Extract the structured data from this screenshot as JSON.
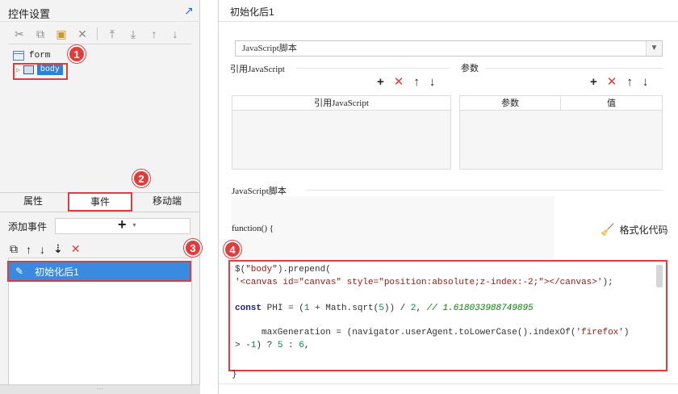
{
  "left": {
    "title": "控件设置",
    "tree": {
      "form": "form",
      "body": "body"
    },
    "tabs": [
      "属性",
      "事件",
      "移动端"
    ],
    "add_event_label": "添加事件",
    "add_event_plus": "+",
    "event_row": "初始化后1",
    "grip": "⋯"
  },
  "badges": [
    "1",
    "2",
    "3",
    "4"
  ],
  "right": {
    "title": "初始化后1",
    "select_value": "JavaScript脚本",
    "ref_section": "引用JavaScript",
    "param_section": "参数",
    "ref_col": "引用JavaScript",
    "param_cols": [
      "参数",
      "值"
    ],
    "script_section": "JavaScript脚本",
    "function_header": "function() {",
    "format_button": "格式化代码",
    "code": {
      "l1a": "$(",
      "l1b": "\"body\"",
      "l1c": ").prepend(",
      "l2": "'<canvas id=\"canvas\" style=\"position:absolute;z-index:-2;\"></canvas>'",
      "l2end": ");",
      "l4kw": "const",
      "l4a": " PHI = (",
      "l4n1": "1",
      "l4b": " + Math.sqrt(",
      "l4n2": "5",
      "l4c": ")) / ",
      "l4n3": "2",
      "l4d": ", ",
      "l4cmt": "// 1.618033988749895",
      "l6a": "     maxGeneration = (navigator.userAgent.toLowerCase().indexOf(",
      "l6s": "'firefox'",
      "l6b": ")",
      "l7a": "> -",
      "l7n1": "1",
      "l7b": ") ? ",
      "l7n2": "5",
      "l7c": " : ",
      "l7n3": "6",
      "l7d": ","
    },
    "close_brace": "}"
  }
}
